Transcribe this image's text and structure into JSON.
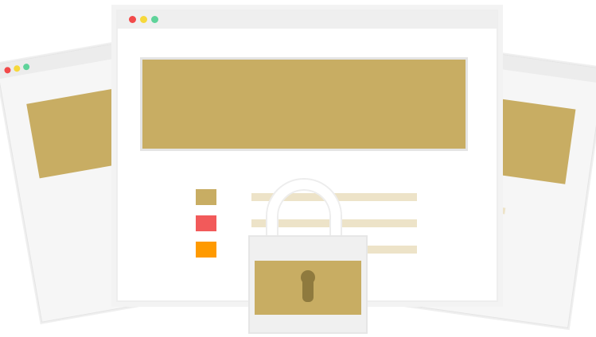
{
  "colors": {
    "gold": "#c8ad63",
    "gold_light": "#ede3c8",
    "red": "#f25a5a",
    "orange": "#ff9a00",
    "keyhole": "#8f7a3e",
    "dot_red": "#f24a4a",
    "dot_yellow": "#f6d83b",
    "dot_green": "#5fd39a"
  },
  "icons": {
    "padlock": "padlock-icon",
    "keyhole": "keyhole-icon"
  }
}
